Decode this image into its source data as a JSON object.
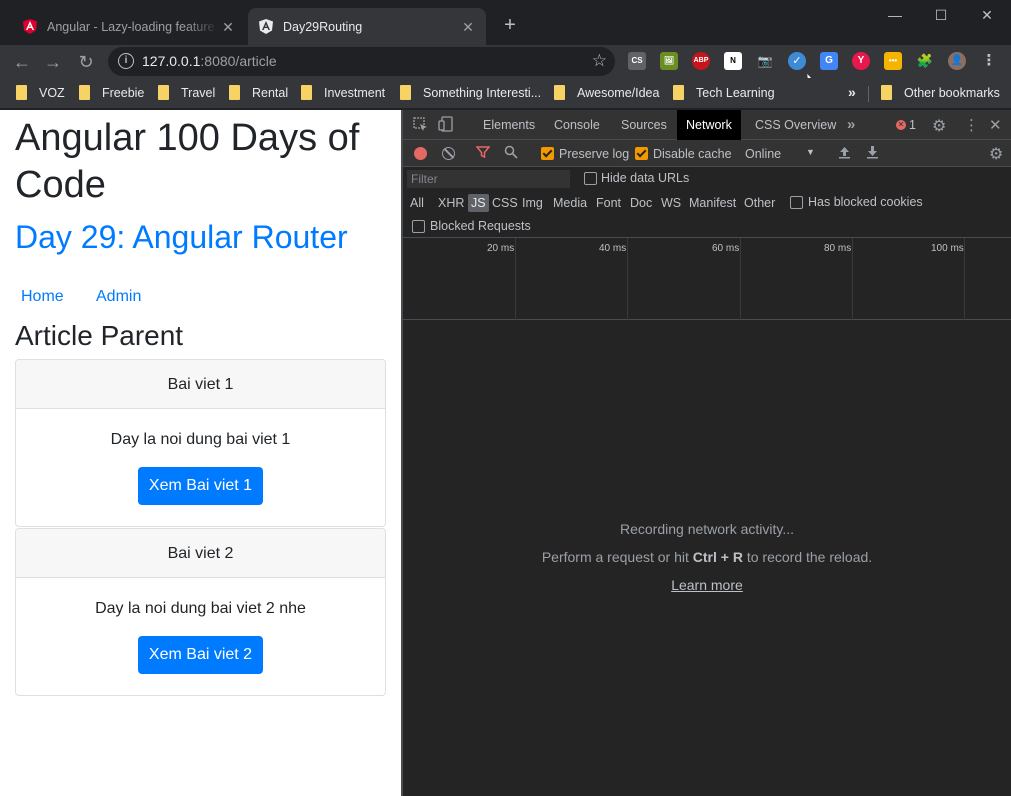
{
  "browser": {
    "tabs": [
      {
        "title": "Angular - Lazy-loading feature m",
        "close": "✕"
      },
      {
        "title": "Day29Routing",
        "close": "✕"
      }
    ],
    "new_tab": "+",
    "window": {
      "minimize": "—",
      "maximize": "☐",
      "close": "✕"
    },
    "nav": {
      "back": "←",
      "forward": "→",
      "reload": "↻"
    },
    "address": {
      "host": "127.0.0.1",
      "path": ":8080/article",
      "info": "i",
      "star": "☆"
    },
    "extensions": [
      "CS",
      "🖼",
      "ABP",
      "N",
      "📷",
      "✓",
      "G",
      "Y",
      "•••",
      "🧩",
      "👤",
      "⋮"
    ],
    "bookmarks": [
      "VOZ",
      "Freebie",
      "Travel",
      "Rental",
      "Investment",
      "Something Interesti...",
      "Awesome/Idea",
      "Tech Learning"
    ],
    "bookmarks_more": "»",
    "other_bookmarks": "Other bookmarks"
  },
  "page": {
    "title": "Angular 100 Days of Code",
    "subtitle": "Day 29: Angular Router",
    "nav": [
      "Home",
      "Admin"
    ],
    "section": "Article Parent",
    "articles": [
      {
        "header": "Bai viet 1",
        "body": "Day la noi dung bai viet 1",
        "button": "Xem Bai viet 1"
      },
      {
        "header": "Bai viet 2",
        "body": "Day la noi dung bai viet 2 nhe",
        "button": "Xem Bai viet 2"
      }
    ]
  },
  "devtools": {
    "tabs": [
      "Elements",
      "Console",
      "Sources",
      "Network",
      "CSS Overview"
    ],
    "active_tab": "Network",
    "more_tabs": "»",
    "error_count": "1",
    "toolbar": {
      "preserve_log": "Preserve log",
      "disable_cache": "Disable cache",
      "throttle": "Online",
      "throttle_arrow": "▼"
    },
    "filter_placeholder": "Filter",
    "hide_data_urls": "Hide data URLs",
    "types": [
      "All",
      "XHR",
      "JS",
      "CSS",
      "Img",
      "Media",
      "Font",
      "Doc",
      "WS",
      "Manifest",
      "Other"
    ],
    "selected_type": "JS",
    "has_blocked_cookies": "Has blocked cookies",
    "blocked_requests": "Blocked Requests",
    "timeline_ticks": [
      "20 ms",
      "40 ms",
      "60 ms",
      "80 ms",
      "100 ms"
    ],
    "empty": {
      "line1": "Recording network activity...",
      "line2_pre": "Perform a request or hit ",
      "line2_key": "Ctrl + R",
      "line2_post": " to record the reload.",
      "learn_more": "Learn more"
    }
  },
  "colors": {
    "accent": "#007bff",
    "chrome_dark": "#202124",
    "devtools_bg": "#242424",
    "record": "#e46962",
    "checkbox": "#f29900"
  }
}
